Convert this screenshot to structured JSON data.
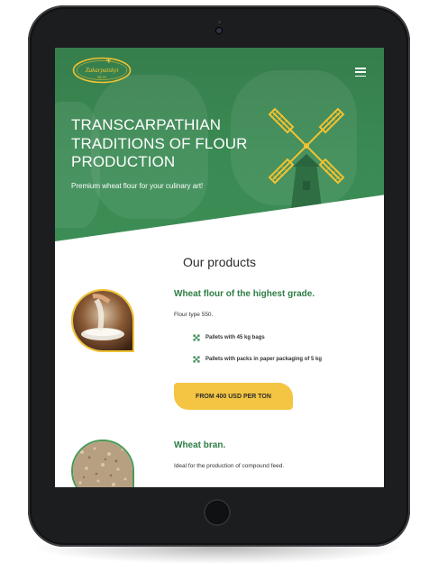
{
  "header": {
    "logo_text": "Zakarpatskyi",
    "logo_sub": "MLYN",
    "menu_icon": "hamburger-icon"
  },
  "hero": {
    "title_line1": "TRANSCARPATHIAN",
    "title_line2": "TRADITIONS OF FLOUR",
    "title_line3": "PRODUCTION",
    "subtitle": "Premium wheat flour for your culinary art!"
  },
  "products_section": {
    "title": "Our products"
  },
  "products": [
    {
      "name": "Wheat flour of the highest grade.",
      "description": "Flour type 550.",
      "features": [
        "Pallets with 45 kg bags",
        "Pallets with packs in paper packaging of 5 kg"
      ],
      "feature_icon": "cross-arrows-icon",
      "price_button": "FROM 400 USD PER TON"
    },
    {
      "name": "Wheat bran.",
      "description": "Ideal for the production of compound feed."
    }
  ],
  "colors": {
    "brand_green": "#3a8a53",
    "accent_yellow": "#f4c542",
    "heading_green": "#2e7d45"
  }
}
